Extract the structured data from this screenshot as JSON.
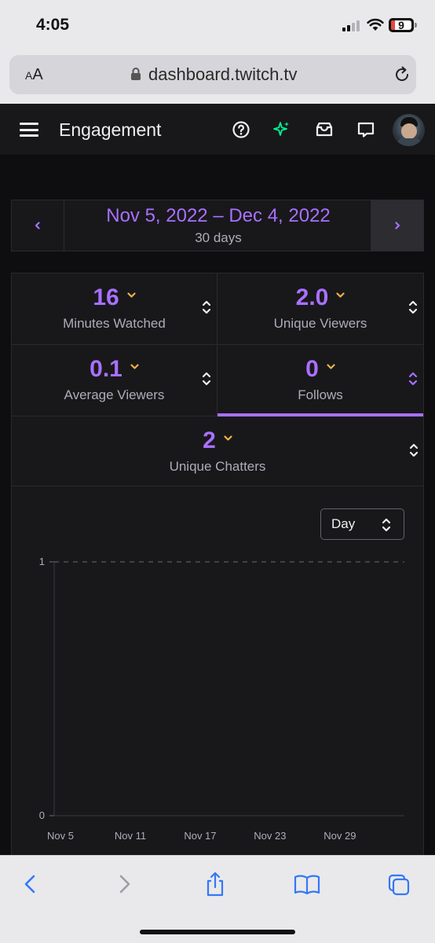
{
  "status": {
    "time": "4:05",
    "battery": "9"
  },
  "browser": {
    "aa_small": "A",
    "aa_large": "A",
    "url": "dashboard.twitch.tv"
  },
  "header": {
    "title": "Engagement"
  },
  "date_range": {
    "range": "Nov 5, 2022 – Dec 4, 2022",
    "days": "30 days"
  },
  "stats": [
    {
      "value": "16",
      "label": "Minutes Watched"
    },
    {
      "value": "2.0",
      "label": "Unique Viewers"
    },
    {
      "value": "0.1",
      "label": "Average Viewers"
    },
    {
      "value": "0",
      "label": "Follows"
    },
    {
      "value": "2",
      "label": "Unique Chatters"
    }
  ],
  "granularity": {
    "selected": "Day"
  },
  "colors": {
    "accent": "#a970ff",
    "caret": "#f0b342",
    "follow_accent": "#00f593"
  },
  "chart_data": {
    "type": "line",
    "title": "",
    "xlabel": "",
    "ylabel": "",
    "x_ticks": [
      "Nov 5",
      "Nov 11",
      "Nov 17",
      "Nov 23",
      "Nov 29"
    ],
    "y_ticks": [
      "1",
      "0"
    ],
    "ylim": [
      0,
      1
    ],
    "grid": "dashed line at top value",
    "series": [
      {
        "values": [
          0,
          0,
          0,
          0,
          0,
          0,
          0,
          0,
          0,
          0,
          0,
          0,
          0,
          0,
          0,
          0,
          0,
          0,
          0,
          0,
          0,
          0,
          0,
          0,
          0,
          0,
          0,
          0,
          0,
          0
        ]
      }
    ]
  }
}
